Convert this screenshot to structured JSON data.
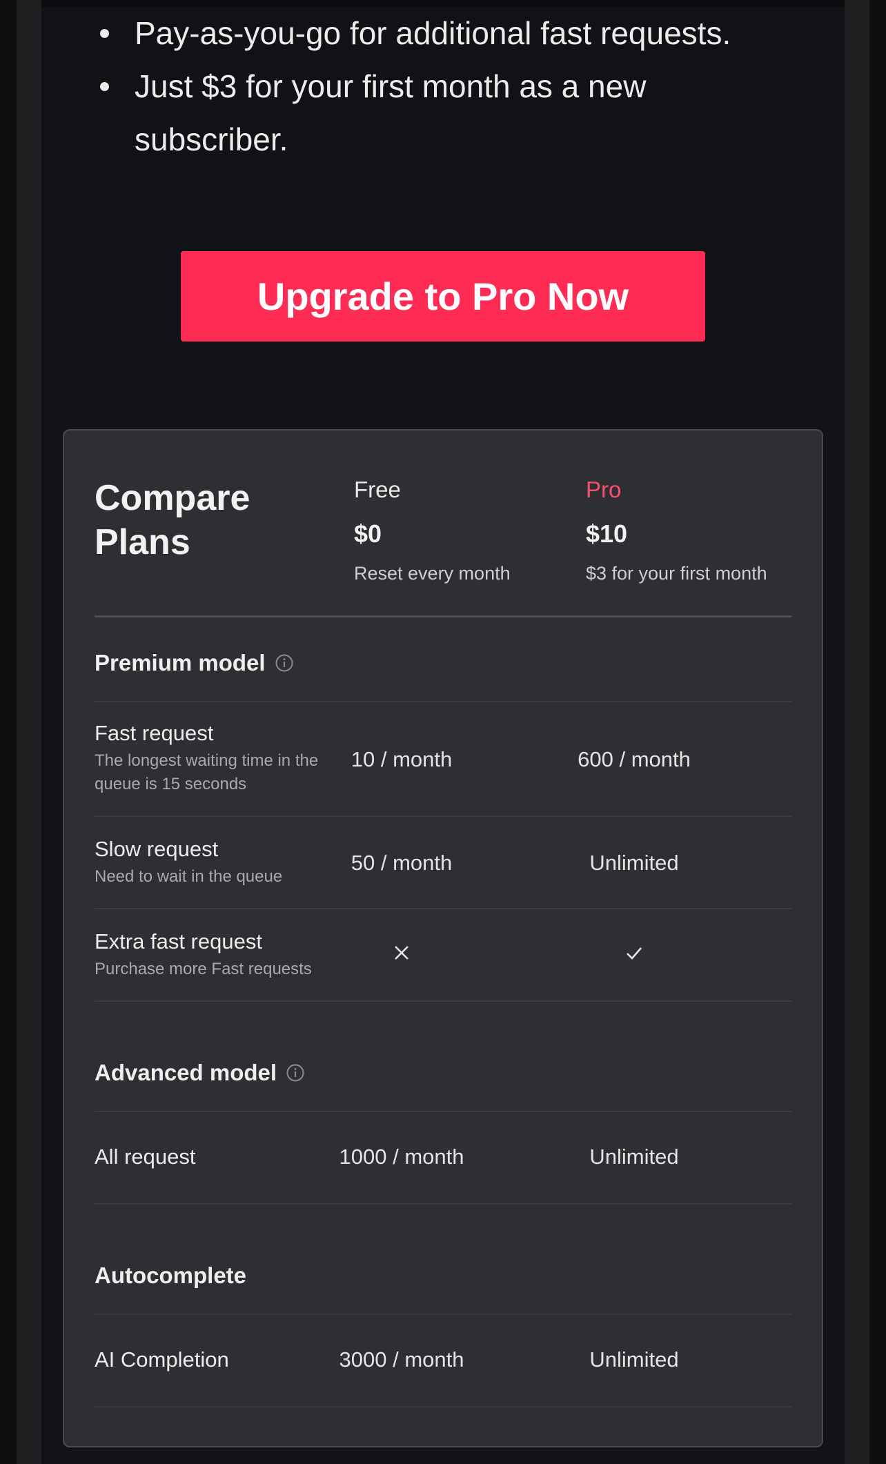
{
  "benefits": [
    "Pay-as-you-go for additional fast requests.",
    "Just $3 for your first month as a new",
    "subscriber."
  ],
  "cta": {
    "label": "Upgrade to Pro Now",
    "color": "#fe2c55"
  },
  "compare": {
    "title": "Compare Plans",
    "plans": {
      "free": {
        "name": "Free",
        "price": "$0",
        "note": "Reset every month"
      },
      "pro": {
        "name": "Pro",
        "price": "$10",
        "note": "$3 for your first month",
        "accent": "#fe4e6d"
      }
    },
    "sections": {
      "premium": {
        "title": "Premium model",
        "icon": "info-icon",
        "rows": [
          {
            "title": "Fast request",
            "subtitle": "The longest waiting time in the queue is 15 seconds",
            "free": "10  / month",
            "pro": "600 / month"
          },
          {
            "title": "Slow request",
            "subtitle": "Need to wait in the queue",
            "free": "50 / month",
            "pro": "Unlimited"
          },
          {
            "title": "Extra fast request",
            "subtitle": "Purchase more Fast requests",
            "free_icon": "cross-icon",
            "pro_icon": "check-icon"
          }
        ]
      },
      "advanced": {
        "title": "Advanced model",
        "icon": "info-icon",
        "rows": [
          {
            "title": "All request",
            "free": "1000  / month",
            "pro": "Unlimited"
          }
        ]
      },
      "autocomplete": {
        "title": "Autocomplete",
        "rows": [
          {
            "title": "AI Completion",
            "free": "3000 / month",
            "pro": "Unlimited"
          }
        ]
      }
    }
  }
}
